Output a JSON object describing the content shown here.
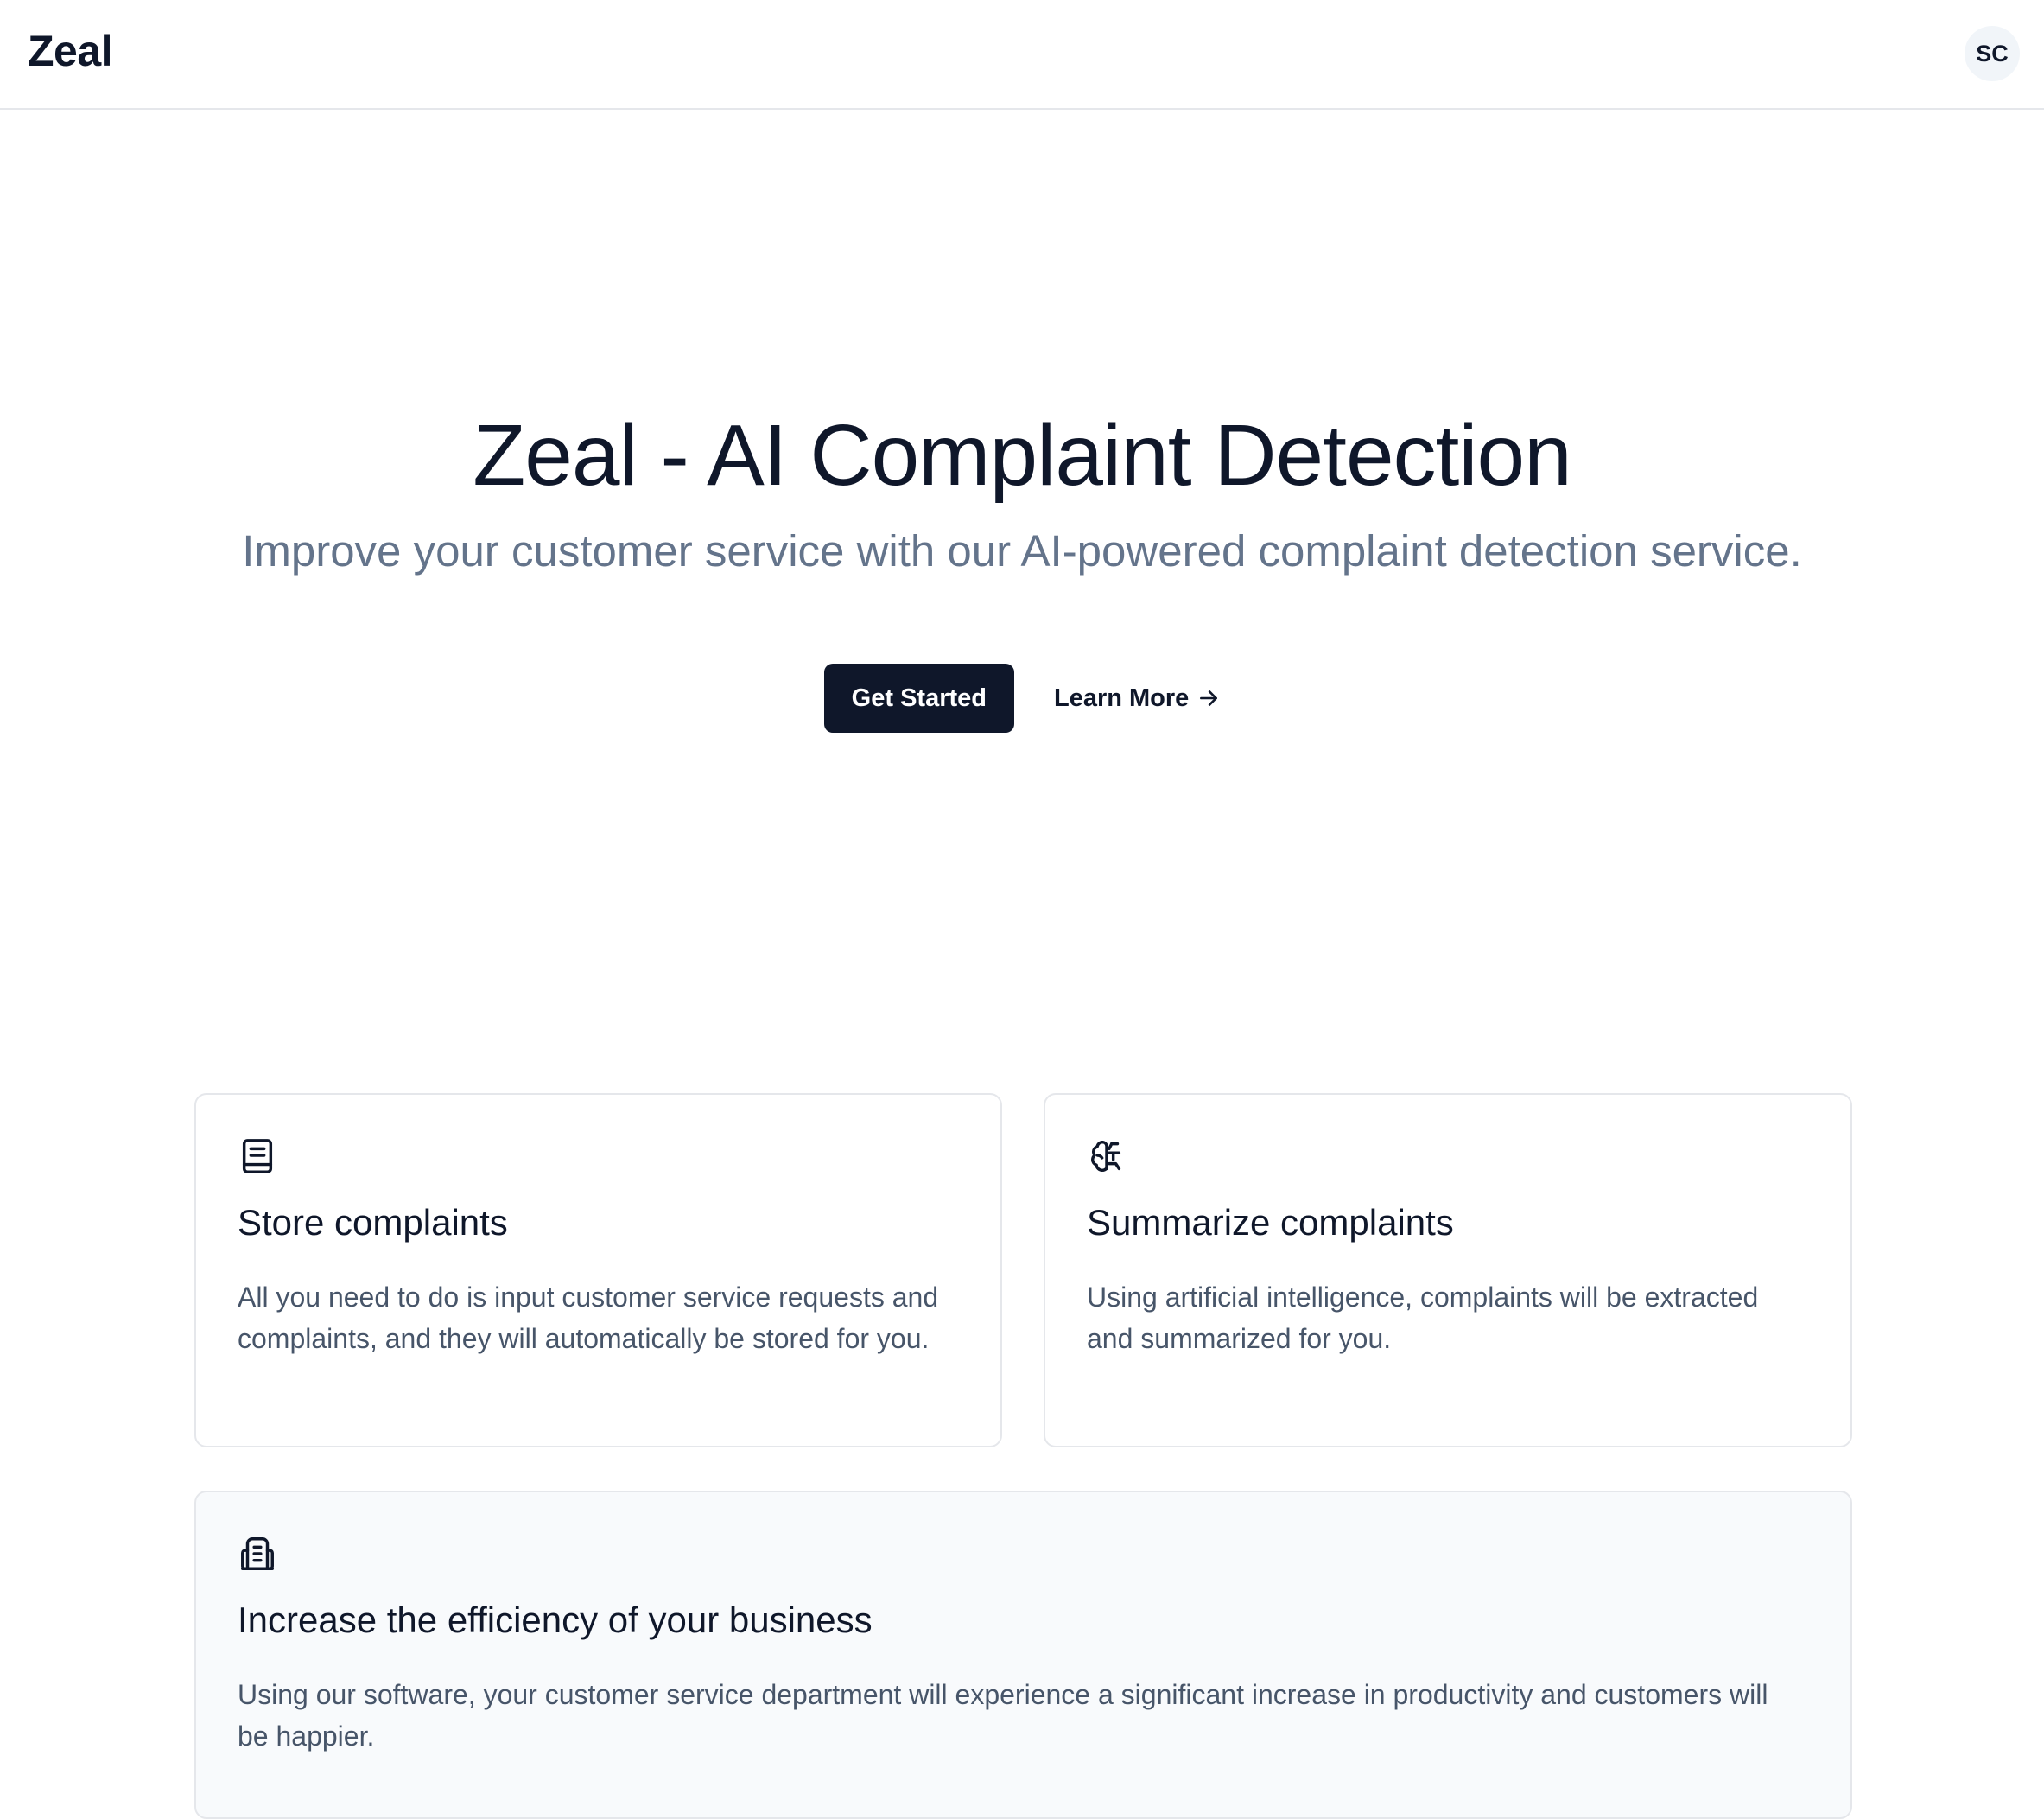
{
  "header": {
    "brand": "Zeal",
    "avatar_initials": "SC"
  },
  "hero": {
    "title": "Zeal - AI Complaint Detection",
    "subtitle": "Improve your customer service with our AI-powered complaint detection service.",
    "primary_cta": "Get Started",
    "secondary_cta": "Learn More",
    "secondary_cta_icon": "arrow-right-icon"
  },
  "features": [
    {
      "icon": "book-icon",
      "title": "Store complaints",
      "text": "All you need to do is input customer service requests and complaints, and they will automatically be stored for you."
    },
    {
      "icon": "brain-icon",
      "title": "Summarize complaints",
      "text": "Using artificial intelligence, complaints will be extracted and summarized for you."
    },
    {
      "icon": "building-icon",
      "title": "Increase the efficiency of your business",
      "text": "Using our software, your customer service department will experience a significant increase in productivity and customers will be happier."
    }
  ],
  "colors": {
    "primary": "#0f172a",
    "muted_text": "#64748b",
    "body_text": "#475569",
    "border": "#e5e7eb",
    "card_alt_bg": "#f8fafc"
  }
}
